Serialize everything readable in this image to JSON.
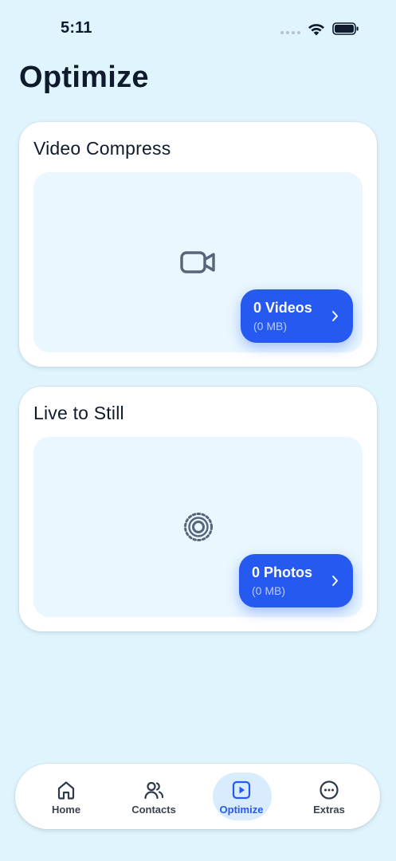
{
  "status_bar": {
    "time": "5:11"
  },
  "page": {
    "title": "Optimize"
  },
  "cards": [
    {
      "title": "Video Compress",
      "icon": "video-camera-icon",
      "button": {
        "count_label": "0 Videos",
        "size_label": "(0 MB)"
      }
    },
    {
      "title": "Live to Still",
      "icon": "live-photo-icon",
      "button": {
        "count_label": "0 Photos",
        "size_label": "(0 MB)"
      }
    }
  ],
  "tab_bar": {
    "items": [
      {
        "label": "Home",
        "icon": "home-icon",
        "active": false
      },
      {
        "label": "Contacts",
        "icon": "contacts-icon",
        "active": false
      },
      {
        "label": "Optimize",
        "icon": "play-square-icon",
        "active": true
      },
      {
        "label": "Extras",
        "icon": "more-circle-icon",
        "active": false
      }
    ]
  },
  "colors": {
    "background": "#dff4fd",
    "accent": "#2559f0",
    "panel": "#eaf7fe",
    "active_tab_bg": "#d8ecfd"
  }
}
